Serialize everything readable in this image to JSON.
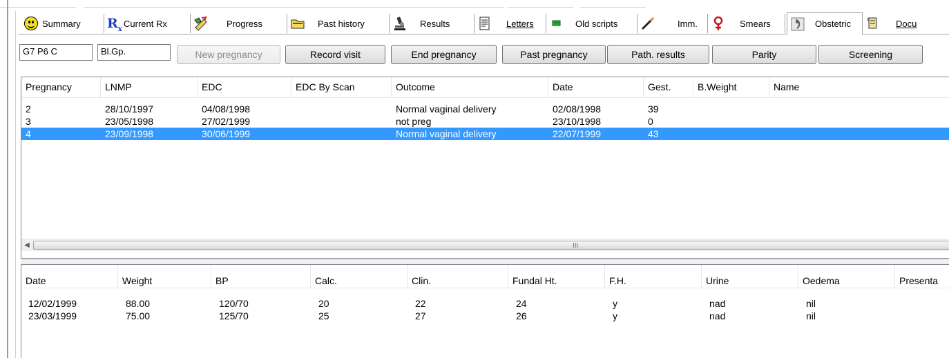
{
  "tabs": [
    {
      "label": "Summary",
      "mnemonic": "y",
      "icon": "smiley-icon"
    },
    {
      "label": "Current Rx",
      "mnemonic": "x",
      "icon": "rx-icon"
    },
    {
      "label": "Progress",
      "mnemonic": "g",
      "icon": "progress-pencil-icon"
    },
    {
      "label": "Past history",
      "mnemonic": "h",
      "icon": "folder-icon"
    },
    {
      "label": "Results",
      "mnemonic": "u",
      "icon": "microscope-icon"
    },
    {
      "label": "Letters",
      "mnemonic": "L",
      "icon": "document-icon"
    },
    {
      "label": "Old scripts",
      "mnemonic": "O",
      "icon": "green-chip-icon"
    },
    {
      "label": "Imm.",
      "mnemonic": "I",
      "icon": "syringe-icon"
    },
    {
      "label": "Smears",
      "mnemonic": "m",
      "icon": "female-symbol-icon"
    },
    {
      "label": "Obstetric",
      "mnemonic": "b",
      "icon": "obstetric-icon",
      "active": true
    },
    {
      "label": "Docu",
      "mnemonic": "D",
      "icon": "scroll-icon"
    }
  ],
  "toolbar": {
    "parity_field": "G7 P6 C",
    "bloodgroup_field": "Bl.Gp.",
    "new_pregnancy": "New pregnancy",
    "record_visit": "Record visit",
    "end_pregnancy": "End pregnancy",
    "past_pregnancy": "Past pregnancy",
    "path_results": "Path. results",
    "parity": "Parity",
    "screening": "Screening"
  },
  "pregnancies": {
    "columns": [
      "Pregnancy",
      "LNMP",
      "EDC",
      "EDC By Scan",
      "Outcome",
      "Date",
      "Gest.",
      "B.Weight",
      "Name"
    ],
    "rows": [
      [
        "2",
        "28/10/1997",
        "04/08/1998",
        "",
        "Normal vaginal delivery",
        "02/08/1998",
        "39",
        "",
        ""
      ],
      [
        "3",
        "23/05/1998",
        "27/02/1999",
        "",
        "not preg",
        "23/10/1998",
        "0",
        "",
        ""
      ],
      [
        "4",
        "23/09/1998",
        "30/06/1999",
        "",
        "Normal vaginal delivery",
        "22/07/1999",
        "43",
        "",
        ""
      ]
    ],
    "selected_row_index": 2,
    "scroll_grip": "III"
  },
  "visits": {
    "columns": [
      "Date",
      "Weight",
      "BP",
      "Calc.",
      "Clin.",
      "Fundal Ht.",
      "F.H.",
      "Urine",
      "Oedema",
      "Presenta"
    ],
    "rows": [
      [
        "12/02/1999",
        "88.00",
        "120/70",
        "20",
        "22",
        "24",
        "y",
        "nad",
        "nil",
        ""
      ],
      [
        "23/03/1999",
        "75.00",
        "125/70",
        "25",
        "27",
        "26",
        "y",
        "nad",
        "nil",
        ""
      ]
    ]
  },
  "colors": {
    "selection": "#3399ff",
    "rx_blue": "#1f3fbf",
    "smiley_yellow": "#f4e020"
  }
}
